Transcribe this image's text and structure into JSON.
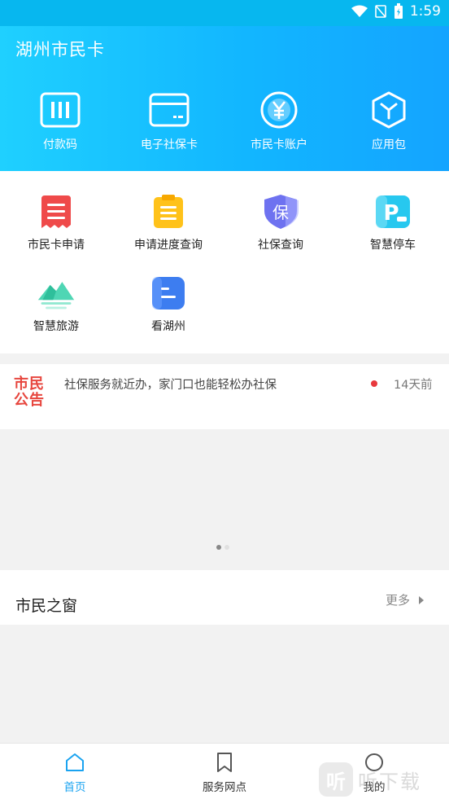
{
  "status": {
    "time": "1:59"
  },
  "header": {
    "title": "湖州市民卡"
  },
  "quick_actions": [
    {
      "label": "付款码",
      "icon": "barcode-icon"
    },
    {
      "label": "电子社保卡",
      "icon": "card-icon"
    },
    {
      "label": "市民卡账户",
      "icon": "yuan-coin-icon"
    },
    {
      "label": "应用包",
      "icon": "package-icon"
    }
  ],
  "services": [
    {
      "label": "市民卡申请",
      "icon": "application-form-icon"
    },
    {
      "label": "申请进度查询",
      "icon": "clipboard-icon"
    },
    {
      "label": "社保查询",
      "icon": "shield-icon",
      "glyph": "保"
    },
    {
      "label": "智慧停车",
      "icon": "parking-icon",
      "glyph": "P"
    },
    {
      "label": "智慧旅游",
      "icon": "mountain-icon"
    },
    {
      "label": "看湖州",
      "icon": "message-icon"
    }
  ],
  "notice": {
    "logo_line1": "市民",
    "logo_line2": "公告",
    "text": "社保服务就近办，家门口也能轻松办社保",
    "time": "14天前"
  },
  "section": {
    "title": "市民之窗",
    "more": "更多"
  },
  "tabs": [
    {
      "label": "首页",
      "icon": "home-icon",
      "active": true
    },
    {
      "label": "服务网点",
      "icon": "bookmark-icon",
      "active": false
    },
    {
      "label": "我的",
      "icon": "user-icon",
      "active": false
    }
  ],
  "watermark": {
    "logo": "听",
    "text": "听下载"
  },
  "colors": {
    "accent": "#1aa3f0",
    "header_start": "#1fd0ff",
    "header_end": "#14a4ff",
    "notice_red": "#e7473f"
  }
}
